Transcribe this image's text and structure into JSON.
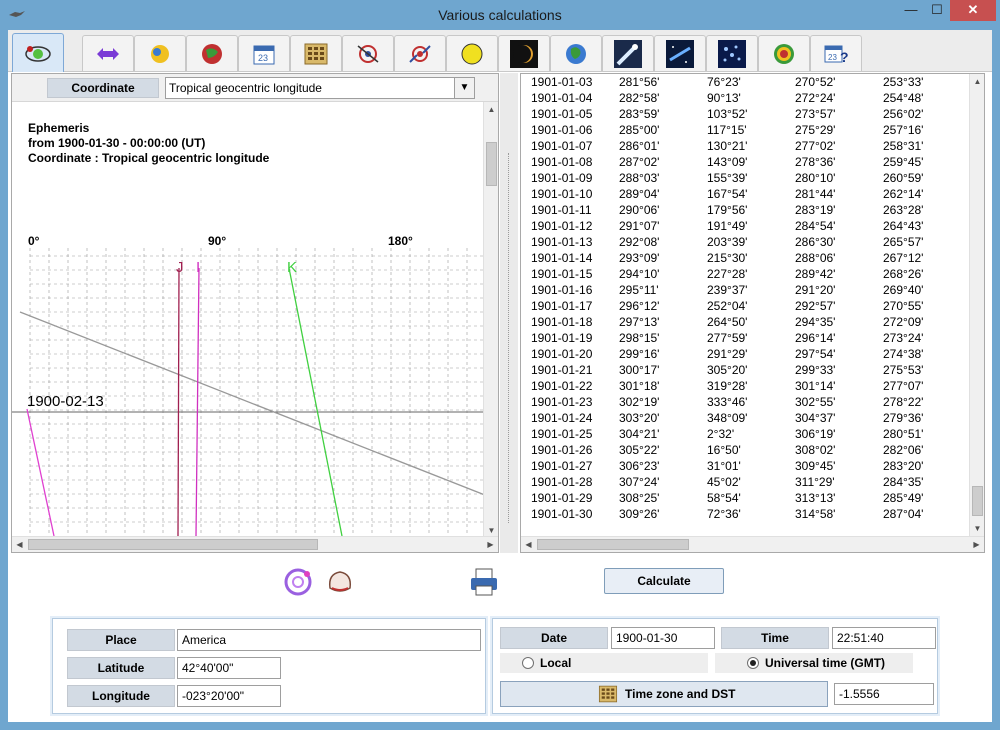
{
  "window": {
    "title": "Various calculations"
  },
  "toolbar": {
    "icons": [
      "orbit-icon",
      "swap-arrows-icon",
      "sun-icon",
      "globe-red-icon",
      "calendar-icon",
      "calculator-icon",
      "satellite-icon",
      "conjunction-icon",
      "moon-icon",
      "eclipse-icon",
      "earth-icon",
      "comet-icon",
      "galaxy-icon",
      "star-cluster-icon",
      "rainbow-icon",
      "calendar-help-icon"
    ]
  },
  "left": {
    "coordinate_label": "Coordinate",
    "coordinate_value": "Tropical geocentric longitude",
    "eph_title": "Ephemeris",
    "eph_from": "from  1900-01-30 - 00:00:00 (UT)",
    "eph_coord": "Coordinate :  Tropical geocentric longitude",
    "axis_0": "0°",
    "axis_90": "90°",
    "axis_180": "180°",
    "label_j": "J",
    "label_i": "I",
    "label_k": "K",
    "date_marker": "1900-02-13"
  },
  "table": {
    "rows": [
      [
        "1901-01-03",
        "281°56'",
        "76°23'",
        "270°52'",
        "253°33'"
      ],
      [
        "1901-01-04",
        "282°58'",
        "90°13'",
        "272°24'",
        "254°48'"
      ],
      [
        "1901-01-05",
        "283°59'",
        "103°52'",
        "273°57'",
        "256°02'"
      ],
      [
        "1901-01-06",
        "285°00'",
        "117°15'",
        "275°29'",
        "257°16'"
      ],
      [
        "1901-01-07",
        "286°01'",
        "130°21'",
        "277°02'",
        "258°31'"
      ],
      [
        "1901-01-08",
        "287°02'",
        "143°09'",
        "278°36'",
        "259°45'"
      ],
      [
        "1901-01-09",
        "288°03'",
        "155°39'",
        "280°10'",
        "260°59'"
      ],
      [
        "1901-01-10",
        "289°04'",
        "167°54'",
        "281°44'",
        "262°14'"
      ],
      [
        "1901-01-11",
        "290°06'",
        "179°56'",
        "283°19'",
        "263°28'"
      ],
      [
        "1901-01-12",
        "291°07'",
        "191°49'",
        "284°54'",
        "264°43'"
      ],
      [
        "1901-01-13",
        "292°08'",
        "203°39'",
        "286°30'",
        "265°57'"
      ],
      [
        "1901-01-14",
        "293°09'",
        "215°30'",
        "288°06'",
        "267°12'"
      ],
      [
        "1901-01-15",
        "294°10'",
        "227°28'",
        "289°42'",
        "268°26'"
      ],
      [
        "1901-01-16",
        "295°11'",
        "239°37'",
        "291°20'",
        "269°40'"
      ],
      [
        "1901-01-17",
        "296°12'",
        "252°04'",
        "292°57'",
        "270°55'"
      ],
      [
        "1901-01-18",
        "297°13'",
        "264°50'",
        "294°35'",
        "272°09'"
      ],
      [
        "1901-01-19",
        "298°15'",
        "277°59'",
        "296°14'",
        "273°24'"
      ],
      [
        "1901-01-20",
        "299°16'",
        "291°29'",
        "297°54'",
        "274°38'"
      ],
      [
        "1901-01-21",
        "300°17'",
        "305°20'",
        "299°33'",
        "275°53'"
      ],
      [
        "1901-01-22",
        "301°18'",
        "319°28'",
        "301°14'",
        "277°07'"
      ],
      [
        "1901-01-23",
        "302°19'",
        "333°46'",
        "302°55'",
        "278°22'"
      ],
      [
        "1901-01-24",
        "303°20'",
        "348°09'",
        "304°37'",
        "279°36'"
      ],
      [
        "1901-01-25",
        "304°21'",
        "2°32'",
        "306°19'",
        "280°51'"
      ],
      [
        "1901-01-26",
        "305°22'",
        "16°50'",
        "308°02'",
        "282°06'"
      ],
      [
        "1901-01-27",
        "306°23'",
        "31°01'",
        "309°45'",
        "283°20'"
      ],
      [
        "1901-01-28",
        "307°24'",
        "45°02'",
        "311°29'",
        "284°35'"
      ],
      [
        "1901-01-29",
        "308°25'",
        "58°54'",
        "313°13'",
        "285°49'"
      ],
      [
        "1901-01-30",
        "309°26'",
        "72°36'",
        "314°58'",
        "287°04'"
      ]
    ]
  },
  "actions": {
    "calculate": "Calculate"
  },
  "location": {
    "place_label": "Place",
    "place_value": "America",
    "latitude_label": "Latitude",
    "latitude_value": "42°40'00\"",
    "longitude_label": "Longitude",
    "longitude_value": "-023°20'00\""
  },
  "datetime": {
    "date_label": "Date",
    "date_value": "1900-01-30",
    "time_label": "Time",
    "time_value": "22:51:40",
    "local_label": "Local",
    "ut_label": "Universal time (GMT)",
    "tz_button": "Time zone and DST",
    "tz_value": "-1.5556"
  }
}
